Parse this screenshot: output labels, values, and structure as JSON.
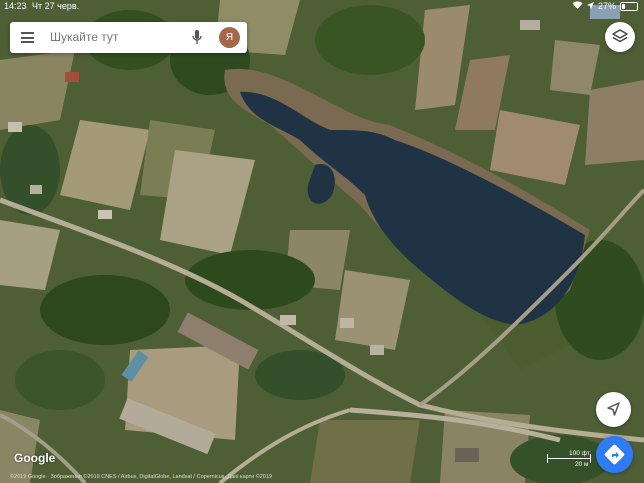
{
  "status_bar": {
    "time": "14:23",
    "date": "Чт 27 черв.",
    "battery_percent": "27%"
  },
  "search": {
    "placeholder": "Шукайте тут",
    "avatar_letter": "Я",
    "avatar_color": "#a4664c"
  },
  "map": {
    "type": "satellite",
    "logo": "Google",
    "attribution": "©2019 Google · Зображення ©2019 CNES / Airbus, DigitalGlobe, Landsat / Copernicus, Дані карти ©2019",
    "scale": {
      "top_label": "100 фт",
      "bottom_label": "20 м"
    }
  },
  "controls": {
    "layers_icon": "layers-icon",
    "locate_icon": "my-location-icon",
    "directions_icon": "directions-icon",
    "directions_color": "#2f7bf5"
  }
}
